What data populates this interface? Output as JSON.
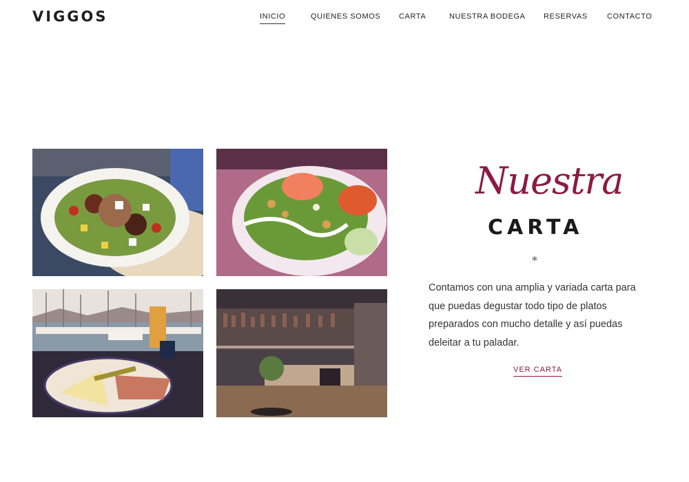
{
  "header": {
    "logo": "VIGGOS",
    "nav": [
      {
        "label": "INICIO",
        "active": true
      },
      {
        "label": "QUIENES SOMOS",
        "active": false
      },
      {
        "label": "CARTA",
        "active": false
      },
      {
        "label": "NUESTRA BODEGA",
        "active": false
      },
      {
        "label": "RESERVAS",
        "active": false
      },
      {
        "label": "CONTACTO",
        "active": false
      }
    ]
  },
  "section": {
    "script_title": "Nuestra",
    "bold_title": "CARTA",
    "ornament": "*",
    "description": "Contamos con una amplia y variada carta para que puedas degustar  todo tipo de platos preparados con mucho detalle y así puedas deleitar a tu paladar.",
    "cta_label": "VER CARTA"
  },
  "gallery": [
    {
      "subject": "salad-bowl-with-cheese-photo"
    },
    {
      "subject": "salmon-salad-photo"
    },
    {
      "subject": "marina-cheese-plate-photo"
    },
    {
      "subject": "bar-interior-photo"
    }
  ],
  "colors": {
    "accent": "#8b1a42",
    "text": "#333333",
    "logo": "#1e1e1e"
  }
}
